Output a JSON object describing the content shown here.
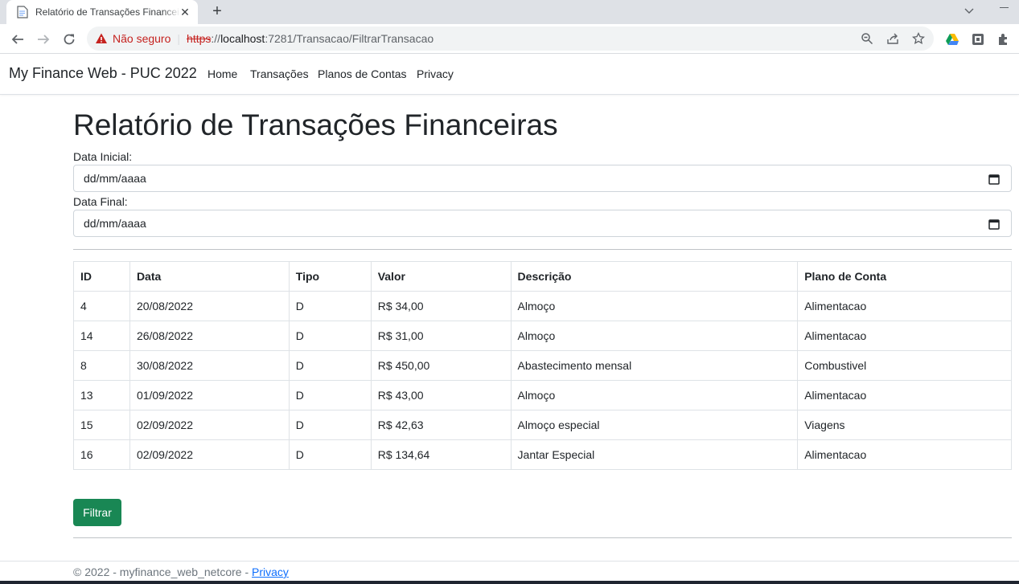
{
  "browser": {
    "tab_title": "Relatório de Transações Financeiras - myfinance_web_netcore",
    "security_label": "Não seguro",
    "url_scheme": "https",
    "url_sep": "://",
    "url_host": "localhost",
    "url_path": ":7281/Transacao/FiltrarTransacao"
  },
  "navbar": {
    "brand": "My Finance Web - PUC 2022",
    "links": [
      "Home",
      "Transações",
      "Planos de Contas",
      "Privacy"
    ]
  },
  "main": {
    "title": "Relatório de Transações Financeiras",
    "start_label": "Data Inicial:",
    "start_placeholder": "dd/mm/aaaa",
    "end_label": "Data Final:",
    "end_placeholder": "dd/mm/aaaa",
    "filter_button": "Filtrar"
  },
  "table": {
    "headers": [
      "ID",
      "Data",
      "Tipo",
      "Valor",
      "Descrição",
      "Plano de Conta"
    ],
    "rows": [
      [
        "4",
        "20/08/2022",
        "D",
        "R$ 34,00",
        "Almoço",
        "Alimentacao"
      ],
      [
        "14",
        "26/08/2022",
        "D",
        "R$ 31,00",
        "Almoço",
        "Alimentacao"
      ],
      [
        "8",
        "30/08/2022",
        "D",
        "R$ 450,00",
        "Abastecimento mensal",
        "Combustivel"
      ],
      [
        "13",
        "01/09/2022",
        "D",
        "R$ 43,00",
        "Almoço",
        "Alimentacao"
      ],
      [
        "15",
        "02/09/2022",
        "D",
        "R$ 42,63",
        "Almoço especial",
        "Viagens"
      ],
      [
        "16",
        "02/09/2022",
        "D",
        "R$ 134,64",
        "Jantar Especial",
        "Alimentacao"
      ]
    ]
  },
  "footer": {
    "text": "© 2022 - myfinance_web_netcore - ",
    "link": "Privacy"
  },
  "colors": {
    "primary_button": "#198754",
    "link": "#0d6efd",
    "not_secure": "#c5221f"
  }
}
